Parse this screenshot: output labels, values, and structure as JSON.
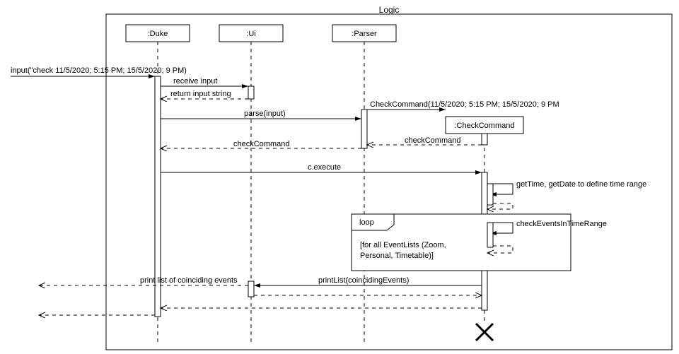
{
  "frame": {
    "title": "Logic"
  },
  "participants": {
    "duke": ":Duke",
    "ui": ":Ui",
    "parser": ":Parser",
    "checkcmd": ":CheckCommand"
  },
  "caller_input": "input(\"check 11/5/2020; 5:15 PM; 15/5/2020; 9 PM)",
  "messages": {
    "receive_input": "receive input",
    "return_input_string": "return input string",
    "parse": "parse(input)",
    "new_cmd": "CheckCommand(11/5/2020; 5:15 PM; 15/5/2020; 9 PM",
    "check_ret1": "checkCommand",
    "check_ret2": "checkCommand",
    "execute": "c.execute",
    "gettime": "getTime, getDate to define time range",
    "check_range": "checkEventsInTimeRange",
    "printlist": "printList(coincidingEvents)",
    "print_out": "print list of coinciding events"
  },
  "loop": {
    "label": "loop",
    "guard": "[for all EventLists (Zoom, Personal, Timetable)]"
  }
}
